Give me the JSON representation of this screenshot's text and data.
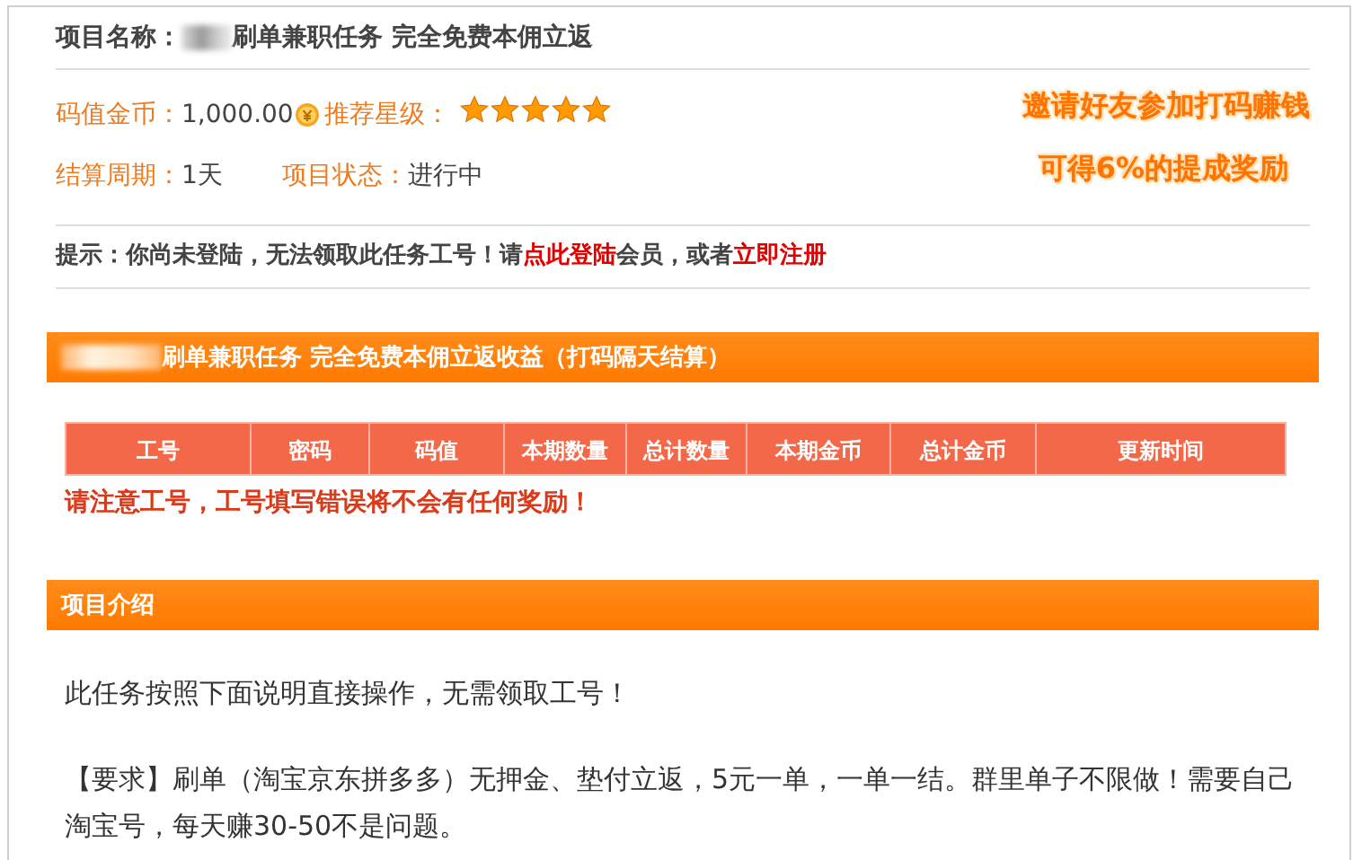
{
  "project": {
    "name_label": "项目名称：",
    "name": "刷单兼职任务 完全免费本佣立返",
    "redacted": true
  },
  "info": {
    "value_label": "码值金币：",
    "value": "1,000.00",
    "rating_label": "推荐星级：",
    "stars": 5,
    "period_label": "结算周期：",
    "period": "1天",
    "status_label": "项目状态：",
    "status": "进行中"
  },
  "promo": [
    "邀请好友参加打码赚钱",
    "可得6%的提成奖励"
  ],
  "tip": [
    {
      "kind": "text",
      "text": "提示：你尚未登陆，无法领取此任务工号！请"
    },
    {
      "kind": "link",
      "text": "点此登陆"
    },
    {
      "kind": "text",
      "text": "会员，或者"
    },
    {
      "kind": "link",
      "text": "立即注册"
    }
  ],
  "earnings": {
    "title": "刷单兼职任务 完全免费本佣立返收益（打码隔天结算）",
    "redacted": true,
    "columns": [
      "工号",
      "密码",
      "码值",
      "本期数量",
      "总计数量",
      "本期金币",
      "总计金币",
      "更新时间"
    ],
    "warning": "请注意工号，工号填写错误将不会有任何奖励！"
  },
  "intro": {
    "title": "项目介绍",
    "paragraphs": [
      "此任务按照下面说明直接操作，无需领取工号！",
      "【要求】刷单（淘宝京东拼多多）无押金、垫付立返，5元一单，一单一结。群里单子不限做！需要自己淘宝号，每天赚30-50不是问题。"
    ]
  }
}
